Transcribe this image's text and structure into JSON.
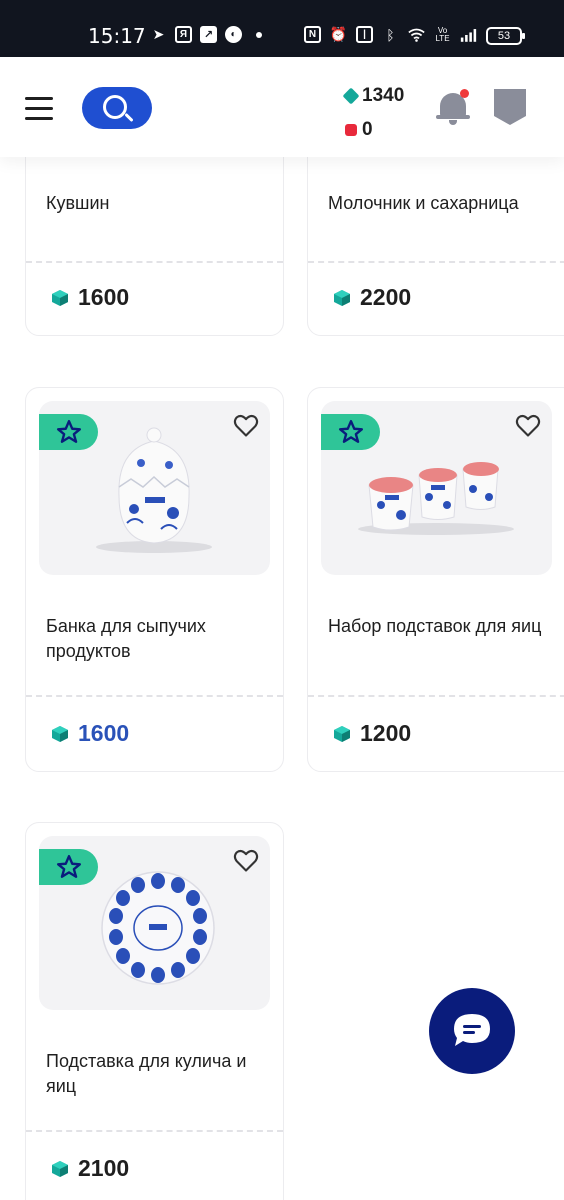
{
  "statusbar": {
    "time": "15:17",
    "battery": "53",
    "left_icons": [
      "telegram-icon",
      "yandex-icon",
      "arrow-app-icon",
      "ball-icon"
    ],
    "right_icons": [
      "nfc-icon",
      "alarm-icon",
      "vibrate-icon",
      "bluetooth-icon",
      "wifi-icon",
      "volte-icon",
      "signal-icon"
    ]
  },
  "header": {
    "gems": "1340",
    "rubies": "0",
    "colors": {
      "search": "#1f4fd1",
      "gem": "#14a89a",
      "ruby": "#e8293b",
      "notification_dot": "#ef3b3b"
    }
  },
  "products": [
    {
      "title": "Кувшин",
      "price": "1600",
      "price_highlight": false
    },
    {
      "title": "Молочник и сахарница",
      "price": "2200",
      "price_highlight": false
    },
    {
      "title": "Банка для сыпучих продуктов",
      "price": "1600",
      "price_highlight": true
    },
    {
      "title": "Набор подставок для яиц",
      "price": "1200",
      "price_highlight": false
    },
    {
      "title": "Подставка для кулича и яиц",
      "price": "2100",
      "price_highlight": false
    }
  ],
  "colors": {
    "badge": "#2fc598",
    "price_blue": "#2a52b8",
    "chat_fab": "#0a1c7c"
  }
}
